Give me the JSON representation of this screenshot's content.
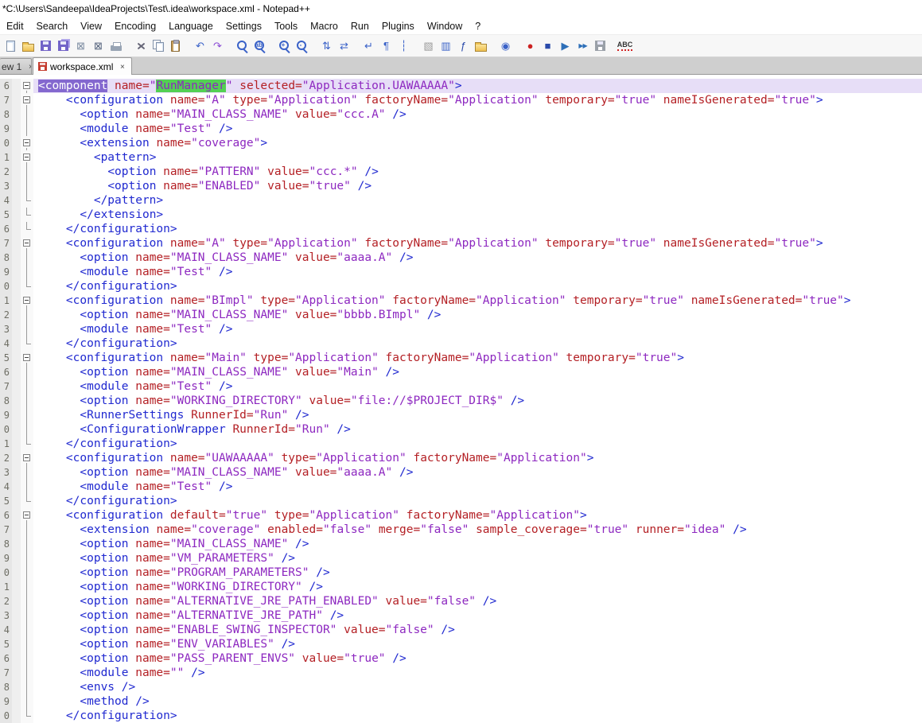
{
  "window": {
    "title": "*C:\\Users\\Sandeepa\\IdeaProjects\\Test\\.idea\\workspace.xml - Notepad++"
  },
  "menu_bar": {
    "items": [
      "Edit",
      "Search",
      "View",
      "Encoding",
      "Language",
      "Settings",
      "Tools",
      "Macro",
      "Run",
      "Plugins",
      "Window",
      "?"
    ]
  },
  "toolbar": {
    "icons": [
      {
        "name": "new-file-icon",
        "shape": "page"
      },
      {
        "name": "open-file-icon",
        "shape": "folder"
      },
      {
        "name": "save-icon",
        "shape": "floppy"
      },
      {
        "name": "save-all-icon",
        "shape": "floppy-multi"
      },
      {
        "name": "close-icon",
        "glyph": "⊠",
        "color": "#7a8aa0"
      },
      {
        "name": "close-all-icon",
        "glyph": "⊠",
        "color": "#51607a"
      },
      {
        "name": "print-icon",
        "shape": "printer"
      },
      {
        "name": "cut-icon",
        "shape": "scissors",
        "gap": true
      },
      {
        "name": "copy-icon",
        "shape": "copy"
      },
      {
        "name": "paste-icon",
        "shape": "paste"
      },
      {
        "name": "undo-icon",
        "glyph": "↶",
        "color": "#3a62c8",
        "gap": true
      },
      {
        "name": "redo-icon",
        "glyph": "↷",
        "color": "#8a4ad4"
      },
      {
        "name": "find-icon",
        "shape": "mag",
        "gap": true
      },
      {
        "name": "replace-icon",
        "shape": "mag",
        "text": "ab"
      },
      {
        "name": "zoom-in-icon",
        "shape": "mag",
        "text": "+",
        "gap": true
      },
      {
        "name": "zoom-out-icon",
        "shape": "mag",
        "text": "-"
      },
      {
        "name": "sync-vertical-icon",
        "glyph": "⇅",
        "color": "#3a62c8",
        "gap": true
      },
      {
        "name": "sync-horizontal-icon",
        "glyph": "⇄",
        "color": "#3a62c8"
      },
      {
        "name": "word-wrap-icon",
        "glyph": "↵",
        "color": "#3a62c8",
        "gap": true
      },
      {
        "name": "show-all-characters-icon",
        "glyph": "¶",
        "color": "#3a62c8"
      },
      {
        "name": "indent-guide-icon",
        "glyph": "┆",
        "color": "#3a62c8"
      },
      {
        "name": "define-language-icon",
        "glyph": "▧",
        "color": "#9a9a9a",
        "gap": true
      },
      {
        "name": "document-map-icon",
        "glyph": "▥",
        "color": "#3a62c8"
      },
      {
        "name": "function-list-icon",
        "glyph": "ƒ",
        "color": "#2a4aaa"
      },
      {
        "name": "folder-as-workspace-icon",
        "shape": "folder"
      },
      {
        "name": "monitoring-icon",
        "glyph": "◉",
        "color": "#3a62c8",
        "gap": true
      },
      {
        "name": "record-macro-icon",
        "glyph": "●",
        "color": "#cc2222",
        "gap": true
      },
      {
        "name": "stop-macro-icon",
        "glyph": "■",
        "color": "#2a4aaa"
      },
      {
        "name": "playback-macro-icon",
        "glyph": "▶",
        "color": "#2d6fb8"
      },
      {
        "name": "run-macro-multiple-icon",
        "glyph": "▶▶",
        "color": "#2d6fb8",
        "small": true
      },
      {
        "name": "save-macro-icon",
        "shape": "floppy-grey"
      },
      {
        "name": "spell-check-icon",
        "shape": "abc",
        "text": "ABC",
        "gap": true
      }
    ]
  },
  "tab_bar": {
    "tabs": [
      {
        "name": "tab-new-1",
        "label": "ew 1",
        "active": false,
        "modified": false,
        "partial": true,
        "close_glyph": "×"
      },
      {
        "name": "tab-workspace-xml",
        "label": "workspace.xml",
        "active": true,
        "modified": true,
        "partial": false,
        "close_glyph": "×"
      }
    ]
  },
  "editor": {
    "lines": [
      {
        "n": "6",
        "f": "start",
        "cur": true,
        "t": "<component name=\"RunManager\" selected=\"Application.UAWAAAAA\">",
        "m": [
          {
            "s": "<component",
            "c": "mk-purple"
          },
          {
            "s": "RunManager",
            "c": "mk-green"
          }
        ]
      },
      {
        "n": "7",
        "f": "start",
        "t": "    <configuration name=\"A\" type=\"Application\" factoryName=\"Application\" temporary=\"true\" nameIsGenerated=\"true\">"
      },
      {
        "n": "8",
        "f": "mid",
        "t": "      <option name=\"MAIN_CLASS_NAME\" value=\"ccc.A\" />"
      },
      {
        "n": "9",
        "f": "mid",
        "t": "      <module name=\"Test\" />"
      },
      {
        "n": "0",
        "f": "start",
        "t": "      <extension name=\"coverage\">"
      },
      {
        "n": "1",
        "f": "start",
        "t": "        <pattern>"
      },
      {
        "n": "2",
        "f": "mid",
        "t": "          <option name=\"PATTERN\" value=\"ccc.*\" />"
      },
      {
        "n": "3",
        "f": "mid",
        "t": "          <option name=\"ENABLED\" value=\"true\" />"
      },
      {
        "n": "4",
        "f": "end",
        "t": "        </pattern>"
      },
      {
        "n": "5",
        "f": "end",
        "t": "      </extension>"
      },
      {
        "n": "6",
        "f": "end",
        "t": "    </configuration>"
      },
      {
        "n": "7",
        "f": "start",
        "t": "    <configuration name=\"A\" type=\"Application\" factoryName=\"Application\" temporary=\"true\" nameIsGenerated=\"true\">"
      },
      {
        "n": "8",
        "f": "mid",
        "t": "      <option name=\"MAIN_CLASS_NAME\" value=\"aaaa.A\" />"
      },
      {
        "n": "9",
        "f": "mid",
        "t": "      <module name=\"Test\" />"
      },
      {
        "n": "0",
        "f": "end",
        "t": "    </configuration>"
      },
      {
        "n": "1",
        "f": "start",
        "t": "    <configuration name=\"BImpl\" type=\"Application\" factoryName=\"Application\" temporary=\"true\" nameIsGenerated=\"true\">"
      },
      {
        "n": "2",
        "f": "mid",
        "t": "      <option name=\"MAIN_CLASS_NAME\" value=\"bbbb.BImpl\" />"
      },
      {
        "n": "3",
        "f": "mid",
        "t": "      <module name=\"Test\" />"
      },
      {
        "n": "4",
        "f": "end",
        "t": "    </configuration>"
      },
      {
        "n": "5",
        "f": "start",
        "t": "    <configuration name=\"Main\" type=\"Application\" factoryName=\"Application\" temporary=\"true\">"
      },
      {
        "n": "6",
        "f": "mid",
        "t": "      <option name=\"MAIN_CLASS_NAME\" value=\"Main\" />"
      },
      {
        "n": "7",
        "f": "mid",
        "t": "      <module name=\"Test\" />"
      },
      {
        "n": "8",
        "f": "mid",
        "t": "      <option name=\"WORKING_DIRECTORY\" value=\"file://$PROJECT_DIR$\" />"
      },
      {
        "n": "9",
        "f": "mid",
        "t": "      <RunnerSettings RunnerId=\"Run\" />"
      },
      {
        "n": "0",
        "f": "mid",
        "t": "      <ConfigurationWrapper RunnerId=\"Run\" />"
      },
      {
        "n": "1",
        "f": "end",
        "t": "    </configuration>"
      },
      {
        "n": "2",
        "f": "start",
        "t": "    <configuration name=\"UAWAAAAA\" type=\"Application\" factoryName=\"Application\">"
      },
      {
        "n": "3",
        "f": "mid",
        "t": "      <option name=\"MAIN_CLASS_NAME\" value=\"aaaa.A\" />"
      },
      {
        "n": "4",
        "f": "mid",
        "t": "      <module name=\"Test\" />"
      },
      {
        "n": "5",
        "f": "end",
        "t": "    </configuration>"
      },
      {
        "n": "6",
        "f": "start",
        "t": "    <configuration default=\"true\" type=\"Application\" factoryName=\"Application\">"
      },
      {
        "n": "7",
        "f": "mid",
        "t": "      <extension name=\"coverage\" enabled=\"false\" merge=\"false\" sample_coverage=\"true\" runner=\"idea\" />"
      },
      {
        "n": "8",
        "f": "mid",
        "t": "      <option name=\"MAIN_CLASS_NAME\" />"
      },
      {
        "n": "9",
        "f": "mid",
        "t": "      <option name=\"VM_PARAMETERS\" />"
      },
      {
        "n": "0",
        "f": "mid",
        "t": "      <option name=\"PROGRAM_PARAMETERS\" />"
      },
      {
        "n": "1",
        "f": "mid",
        "t": "      <option name=\"WORKING_DIRECTORY\" />"
      },
      {
        "n": "2",
        "f": "mid",
        "t": "      <option name=\"ALTERNATIVE_JRE_PATH_ENABLED\" value=\"false\" />"
      },
      {
        "n": "3",
        "f": "mid",
        "t": "      <option name=\"ALTERNATIVE_JRE_PATH\" />"
      },
      {
        "n": "4",
        "f": "mid",
        "t": "      <option name=\"ENABLE_SWING_INSPECTOR\" value=\"false\" />"
      },
      {
        "n": "5",
        "f": "mid",
        "t": "      <option name=\"ENV_VARIABLES\" />"
      },
      {
        "n": "6",
        "f": "mid",
        "t": "      <option name=\"PASS_PARENT_ENVS\" value=\"true\" />"
      },
      {
        "n": "7",
        "f": "mid",
        "t": "      <module name=\"\" />"
      },
      {
        "n": "8",
        "f": "mid",
        "t": "      <envs />"
      },
      {
        "n": "9",
        "f": "mid",
        "t": "      <method />"
      },
      {
        "n": "0",
        "f": "end",
        "t": "    </configuration>"
      }
    ]
  },
  "colors": {
    "tag": "#2029d0",
    "attribute": "#b42025",
    "value": "#8d28c0",
    "current_line_bg": "#e7def7",
    "tag_match_bg": "#8468cf",
    "smart_highlight_bg": "#53d053",
    "line_number": "#6e6e64",
    "modified_tab_icon": "#c43b2e"
  }
}
